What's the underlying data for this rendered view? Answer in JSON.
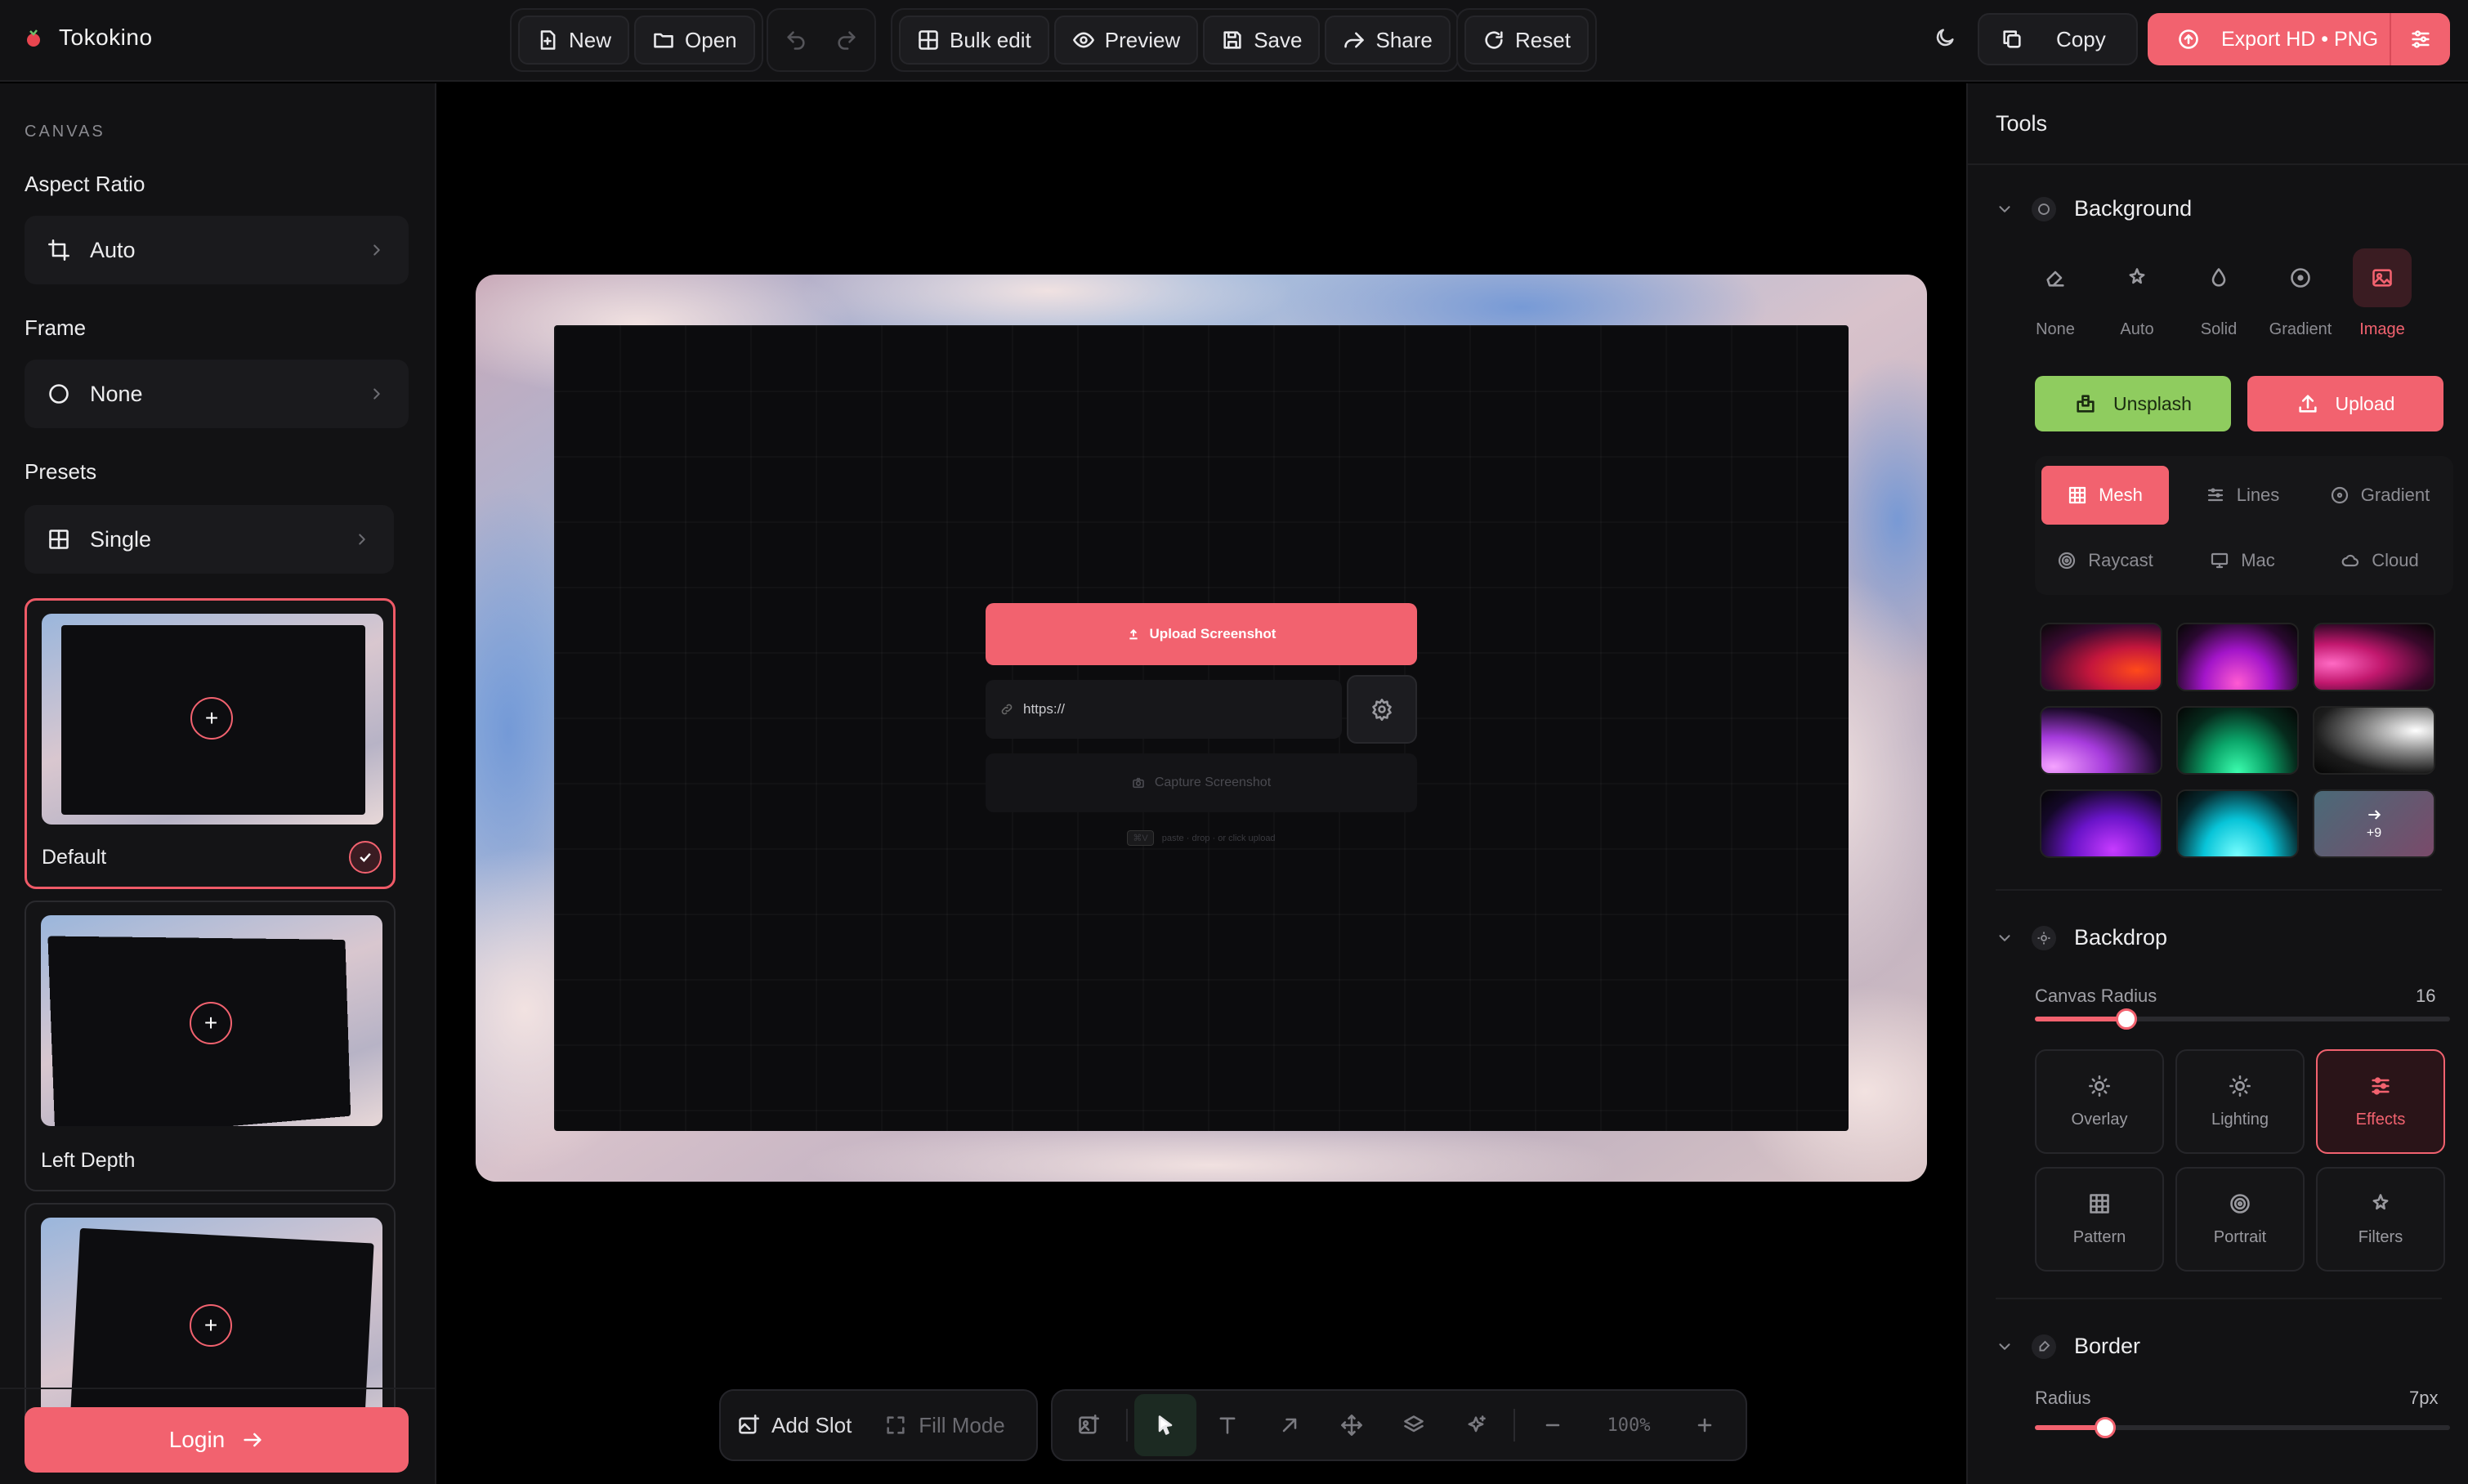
{
  "app": {
    "name": "Tokokino"
  },
  "toolbar": {
    "new": "New",
    "open": "Open",
    "bulk_edit": "Bulk edit",
    "preview": "Preview",
    "save": "Save",
    "share": "Share",
    "reset": "Reset",
    "copy": "Copy",
    "export": "Export HD • PNG"
  },
  "left": {
    "section": "CANVAS",
    "aspect_ratio_label": "Aspect Ratio",
    "aspect_ratio_value": "Auto",
    "frame_label": "Frame",
    "frame_value": "None",
    "presets_label": "Presets",
    "presets_value": "Single",
    "preset_items": [
      {
        "label": "Default",
        "selected": true
      },
      {
        "label": "Left Depth",
        "selected": false
      },
      {
        "label": "",
        "selected": false
      }
    ],
    "login": "Login"
  },
  "canvas": {
    "upload_label": "Upload Screenshot",
    "url_placeholder": "https://",
    "capture_label": "Capture Screenshot",
    "hint_key": "⌘V",
    "hint_text": "paste · drop · or click upload"
  },
  "bottom": {
    "add_slot": "Add Slot",
    "fill_mode": "Fill Mode",
    "zoom": "100%"
  },
  "right": {
    "title": "Tools",
    "background": {
      "title": "Background",
      "options": [
        "None",
        "Auto",
        "Solid",
        "Gradient",
        "Image"
      ],
      "active": "Image",
      "unsplash": "Unsplash",
      "upload": "Upload",
      "styles": [
        "Mesh",
        "Lines",
        "Gradient",
        "Raycast",
        "Mac",
        "Cloud"
      ],
      "active_style": "Mesh",
      "more_count": "+9"
    },
    "backdrop": {
      "title": "Backdrop",
      "canvas_radius_label": "Canvas Radius",
      "canvas_radius_value": "16",
      "canvas_radius_level": 0.22,
      "effects": [
        "Overlay",
        "Lighting",
        "Effects",
        "Pattern",
        "Portrait",
        "Filters"
      ],
      "active_effect": "Effects"
    },
    "border": {
      "title": "Border",
      "radius_label": "Radius",
      "radius_value": "7px",
      "radius_level": 0.17
    }
  },
  "colors": {
    "accent": "#f2626f",
    "unsplash_green": "#8fcc5f",
    "panel": "#121214"
  }
}
